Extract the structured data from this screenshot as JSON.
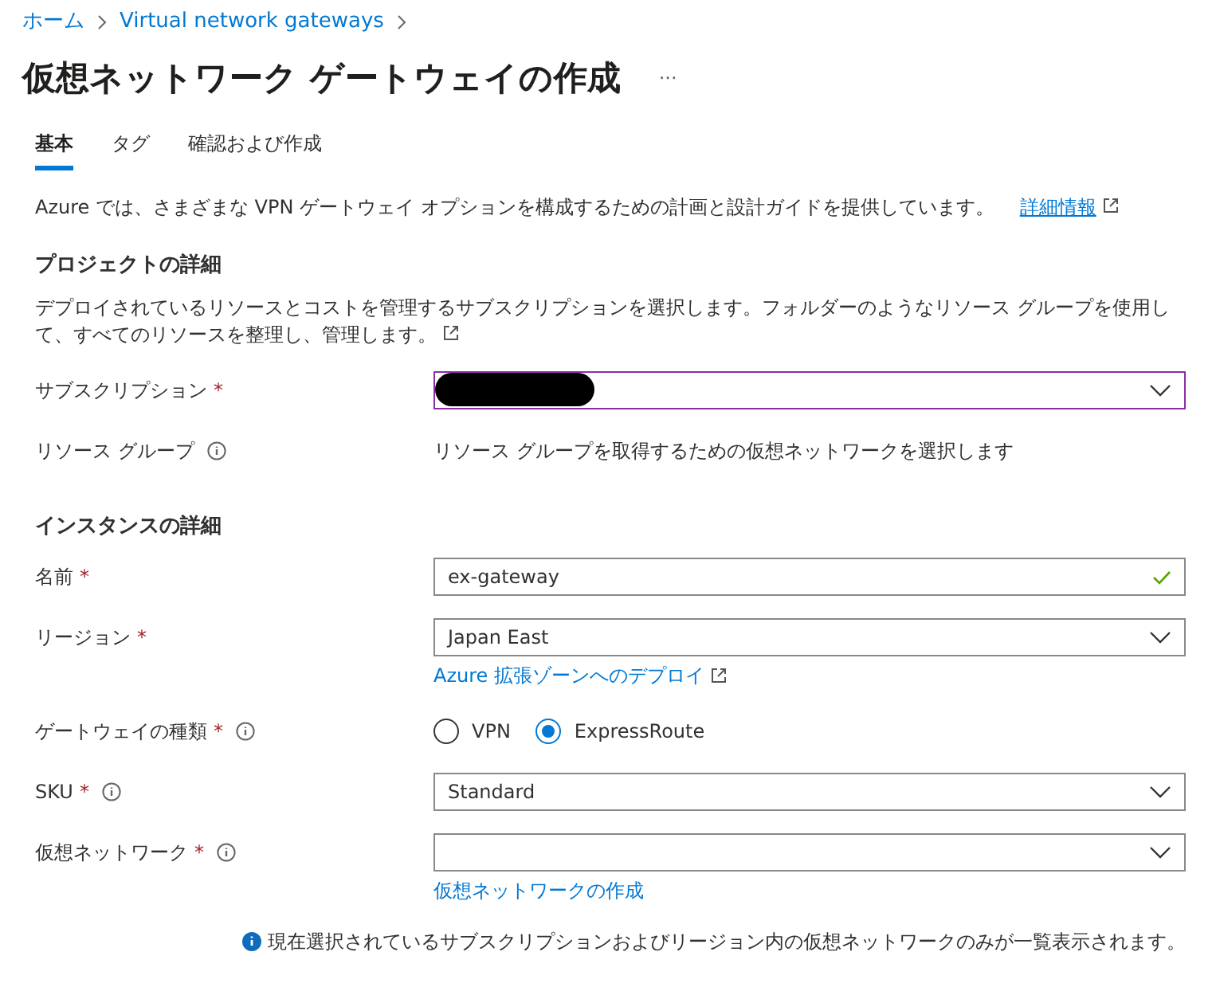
{
  "breadcrumb": [
    {
      "label": "ホーム"
    },
    {
      "label": "Virtual network gateways"
    }
  ],
  "title": "仮想ネットワーク ゲートウェイの作成",
  "more": "···",
  "tabs": [
    {
      "label": "基本",
      "selected": true
    },
    {
      "label": "タグ",
      "selected": false
    },
    {
      "label": "確認および作成",
      "selected": false
    }
  ],
  "intro": {
    "text": "Azure では、さまざまな VPN ゲートウェイ オプションを構成するための計画と設計ガイドを提供しています。",
    "link": "詳細情報"
  },
  "sections": [
    {
      "heading": "プロジェクトの詳細",
      "description": "デプロイされているリソースとコストを管理するサブスクリプションを選択します。フォルダーのようなリソース グループを使用して、すべてのリソースを整理し、管理します。",
      "fields": [
        {
          "kind": "select",
          "label": "サブスクリプション",
          "required": "*",
          "redacted": true,
          "focused": true
        },
        {
          "kind": "note",
          "label": "リソース グループ",
          "info": true,
          "value": "リソース グループを取得するための仮想ネットワークを選択します"
        }
      ]
    },
    {
      "heading": "インスタンスの詳細",
      "fields": [
        {
          "kind": "text",
          "label": "名前",
          "required": "*",
          "value": "ex-gateway",
          "valid": true
        },
        {
          "kind": "select",
          "label": "リージョン",
          "required": "*",
          "value": "Japan East",
          "link": "Azure 拡張ゾーンへのデプロイ",
          "link_external": true
        },
        {
          "kind": "radio",
          "label": "ゲートウェイの種類",
          "required": "*",
          "info": true,
          "options": [
            {
              "label": "VPN",
              "selected": false
            },
            {
              "label": "ExpressRoute",
              "selected": true
            }
          ]
        },
        {
          "kind": "select",
          "label": "SKU",
          "required": "*",
          "info": true,
          "value": "Standard"
        },
        {
          "kind": "select",
          "label": "仮想ネットワーク",
          "required": "*",
          "info": true,
          "link": "仮想ネットワークの作成"
        }
      ]
    }
  ],
  "footer_note": "現在選択されているサブスクリプションおよびリージョン内の仮想ネットワークのみが一覧表示されます。"
}
